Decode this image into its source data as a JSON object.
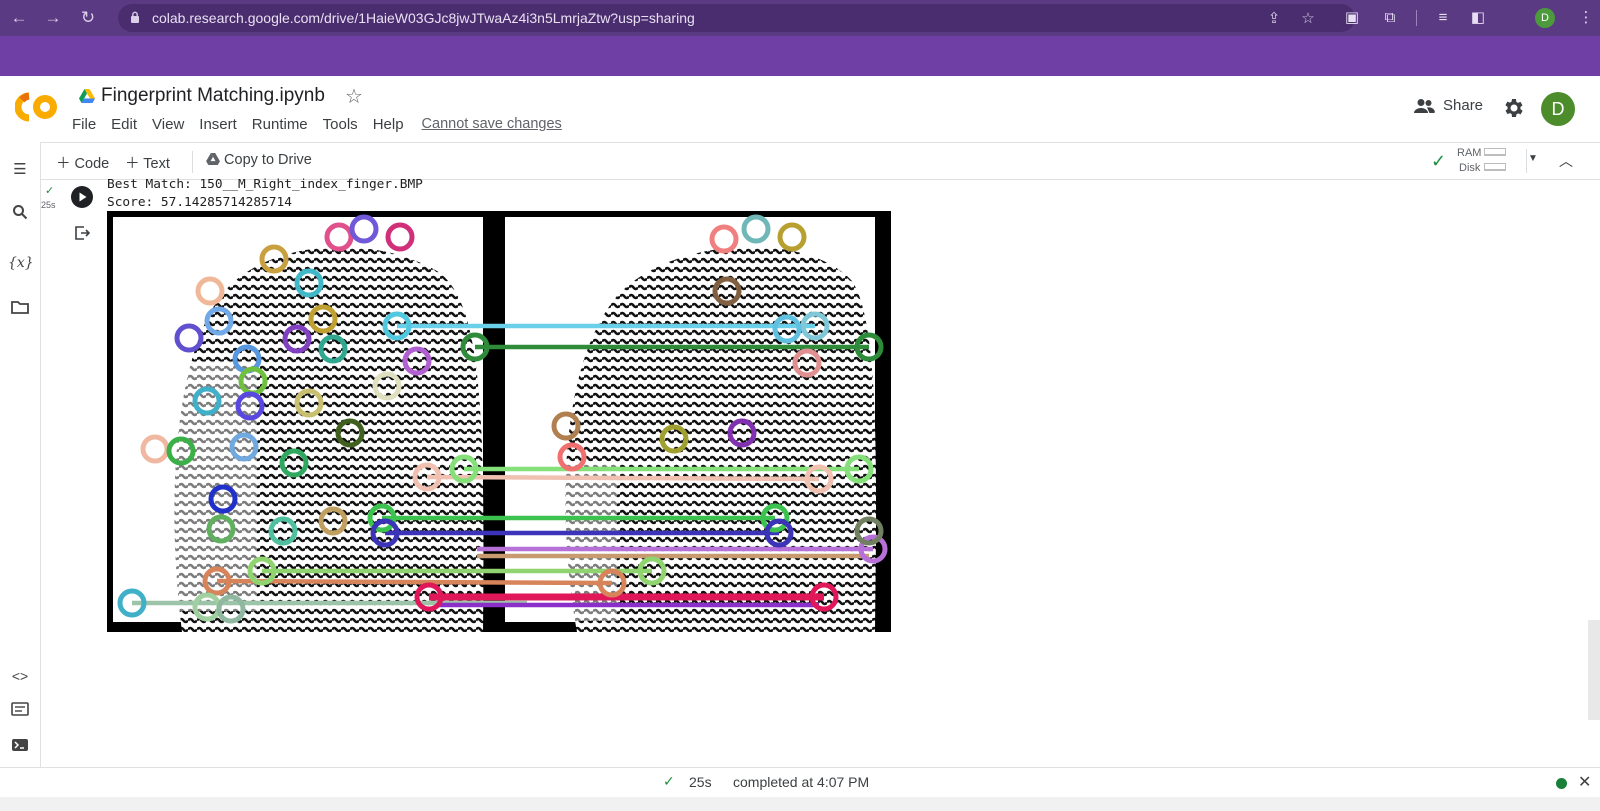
{
  "browser": {
    "url": "colab.research.google.com/drive/1HaieW03GJc8jwJTwaAz4i3n5LmrjaZtw?usp=sharing",
    "profile_initial": "D"
  },
  "notebook": {
    "title": "Fingerprint Matching.ipynb",
    "menu": [
      "File",
      "Edit",
      "View",
      "Insert",
      "Runtime",
      "Tools",
      "Help"
    ],
    "save_status": "Cannot save changes",
    "share_label": "Share",
    "user_initial": "D"
  },
  "toolbar": {
    "code_label": "Code",
    "text_label": "Text",
    "copy_label": "Copy to Drive",
    "ram_label": "RAM",
    "disk_label": "Disk"
  },
  "cell": {
    "exec_time": "25s",
    "output_lines": [
      "Best Match: 150__M_Right_index_finger.BMP",
      "Score: 57.14285714285714"
    ],
    "image_alt": "fingerprint keypoint match visualization"
  },
  "status": {
    "time": "25s",
    "completed": "completed at 4:07 PM"
  },
  "colors": {
    "browser_bar": "#5b3a84",
    "purple_band": "#6f3fa6",
    "colab_orange": "#f9ab00",
    "green": "#1e8e3e"
  }
}
